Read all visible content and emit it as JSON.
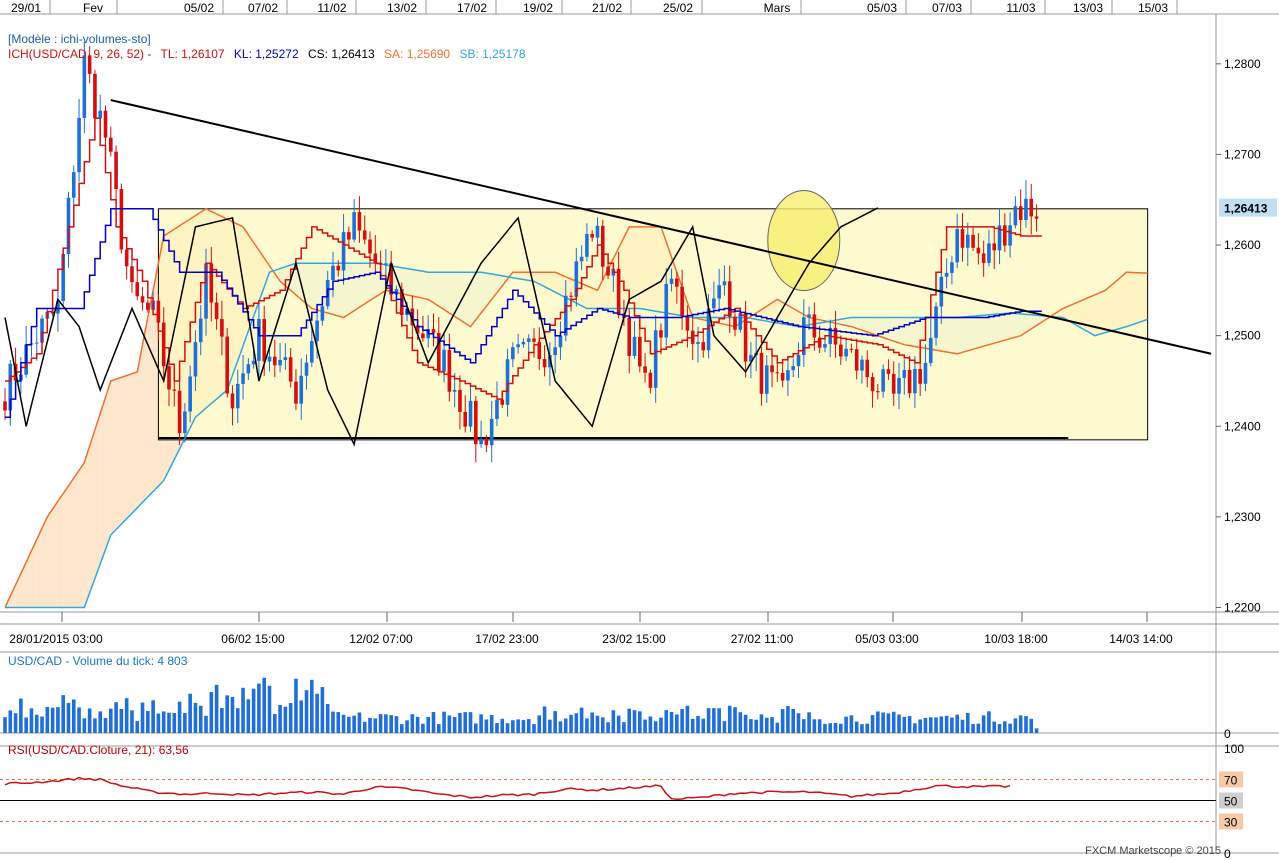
{
  "title": "",
  "top_date_labels": [
    "29/01",
    "Fev",
    "05/02",
    "07/02",
    "11/02",
    "13/02",
    "17/02",
    "19/02",
    "21/02",
    "25/02",
    "Mars",
    "05/03",
    "07/03",
    "11/03",
    "13/03",
    "15/03"
  ],
  "bottom_date_labels": [
    "28/01/2015 03:00",
    "06/02 15:00",
    "12/02 07:00",
    "17/02 23:00",
    "23/02 15:00",
    "27/02 11:00",
    "05/03 03:00",
    "10/03 18:00",
    "14/03 14:00"
  ],
  "legend": {
    "template": "[Modèle : ichi-volumes-sto]",
    "ichimoku": {
      "name": "ICH(USD/CAD, 9, 26, 52) -",
      "tl": "TL: 1,26107",
      "kl": "KL: 1,25272",
      "cs": "CS: 1,26413",
      "sa": "SA: 1,25690",
      "sb": "SB: 1,25178"
    },
    "volume": "USD/CAD - Volume du tick: 4 803",
    "rsi": "RSI(USD/CAD.Cloture, 21): 63,56"
  },
  "watermark": "FXCM Marketscope © 2015",
  "colors": {
    "up": "#1f6fd6",
    "down": "#d21010",
    "tenkan": "#d21010",
    "kijun": "#0000c8",
    "chikou": "#000000",
    "senkou_a": "#f07030",
    "senkou_b": "#30a8e0",
    "cloud_up": "#ddeef8",
    "cloud_down": "#fde6cc",
    "box": "#fdf8c0",
    "circle": "#f8ee6e",
    "price_badge": "#c0dff3"
  },
  "chart_data": [
    {
      "type": "candlestick",
      "name": "price",
      "ylim": [
        1.2195,
        1.2855
      ],
      "y_ticks": [
        "1,2200",
        "1,2300",
        "1,2400",
        "1,2500",
        "1,2600",
        "1,2700",
        "1,2800"
      ],
      "last_price_label": "1,26413",
      "bar_count": 196,
      "close_anchors": [
        [
          0,
          1.244
        ],
        [
          6,
          1.25
        ],
        [
          10,
          1.253
        ],
        [
          15,
          1.28
        ],
        [
          19,
          1.272
        ],
        [
          24,
          1.254
        ],
        [
          28,
          1.252
        ],
        [
          33,
          1.24
        ],
        [
          38,
          1.256
        ],
        [
          43,
          1.243
        ],
        [
          48,
          1.25
        ],
        [
          55,
          1.244
        ],
        [
          61,
          1.256
        ],
        [
          66,
          1.262
        ],
        [
          73,
          1.255
        ],
        [
          78,
          1.251
        ],
        [
          83,
          1.247
        ],
        [
          90,
          1.238
        ],
        [
          96,
          1.247
        ],
        [
          103,
          1.249
        ],
        [
          111,
          1.262
        ],
        [
          116,
          1.254
        ],
        [
          121,
          1.244
        ],
        [
          126,
          1.256
        ],
        [
          131,
          1.249
        ],
        [
          136,
          1.256
        ],
        [
          141,
          1.247
        ],
        [
          147,
          1.243
        ],
        [
          151,
          1.251
        ],
        [
          159,
          1.248
        ],
        [
          168,
          1.243
        ],
        [
          174,
          1.247
        ],
        [
          180,
          1.262
        ],
        [
          185,
          1.258
        ],
        [
          191,
          1.2641
        ]
      ],
      "overlays": {
        "tenkan_anchors": [
          [
            0,
            1.245
          ],
          [
            6,
            1.248
          ],
          [
            12,
            1.262
          ],
          [
            17,
            1.274
          ],
          [
            21,
            1.262
          ],
          [
            26,
            1.256
          ],
          [
            32,
            1.245
          ],
          [
            38,
            1.258
          ],
          [
            45,
            1.253
          ],
          [
            52,
            1.255
          ],
          [
            58,
            1.262
          ],
          [
            64,
            1.26
          ],
          [
            70,
            1.258
          ],
          [
            78,
            1.247
          ],
          [
            86,
            1.245
          ],
          [
            93,
            1.243
          ],
          [
            100,
            1.249
          ],
          [
            107,
            1.254
          ],
          [
            112,
            1.26
          ],
          [
            117,
            1.255
          ],
          [
            122,
            1.248
          ],
          [
            130,
            1.25
          ],
          [
            138,
            1.253
          ],
          [
            146,
            1.247
          ],
          [
            155,
            1.25
          ],
          [
            165,
            1.249
          ],
          [
            172,
            1.247
          ],
          [
            178,
            1.262
          ],
          [
            186,
            1.262
          ],
          [
            192,
            1.261
          ]
        ],
        "kijun_anchors": [
          [
            0,
            1.241
          ],
          [
            6,
            1.253
          ],
          [
            14,
            1.253
          ],
          [
            20,
            1.264
          ],
          [
            27,
            1.264
          ],
          [
            33,
            1.257
          ],
          [
            40,
            1.257
          ],
          [
            48,
            1.25
          ],
          [
            55,
            1.25
          ],
          [
            62,
            1.256
          ],
          [
            70,
            1.257
          ],
          [
            78,
            1.251
          ],
          [
            88,
            1.247
          ],
          [
            96,
            1.255
          ],
          [
            104,
            1.25
          ],
          [
            112,
            1.253
          ],
          [
            118,
            1.252
          ],
          [
            127,
            1.252
          ],
          [
            136,
            1.253
          ],
          [
            150,
            1.251
          ],
          [
            164,
            1.25
          ],
          [
            174,
            1.252
          ],
          [
            185,
            1.252
          ],
          [
            192,
            1.2527
          ]
        ],
        "chikou_anchors": [
          [
            0,
            1.252
          ],
          [
            4,
            1.24
          ],
          [
            10,
            1.254
          ],
          [
            14,
            1.251
          ],
          [
            18,
            1.244
          ],
          [
            24,
            1.253
          ],
          [
            30,
            1.245
          ],
          [
            36,
            1.262
          ],
          [
            43,
            1.263
          ],
          [
            48,
            1.245
          ],
          [
            55,
            1.258
          ],
          [
            61,
            1.244
          ],
          [
            66,
            1.238
          ],
          [
            73,
            1.258
          ],
          [
            80,
            1.247
          ],
          [
            90,
            1.258
          ],
          [
            97,
            1.263
          ],
          [
            104,
            1.245
          ],
          [
            111,
            1.24
          ],
          [
            118,
            1.254
          ],
          [
            124,
            1.256
          ],
          [
            130,
            1.262
          ],
          [
            134,
            1.25
          ],
          [
            140,
            1.246
          ],
          [
            147,
            1.253
          ],
          [
            152,
            1.258
          ],
          [
            158,
            1.262
          ],
          [
            165,
            1.2641
          ]
        ],
        "senkou_a_anchors": [
          [
            0,
            1.22
          ],
          [
            8,
            1.23
          ],
          [
            15,
            1.236
          ],
          [
            20,
            1.245
          ],
          [
            25,
            1.246
          ],
          [
            30,
            1.261
          ],
          [
            38,
            1.264
          ],
          [
            45,
            1.262
          ],
          [
            52,
            1.256
          ],
          [
            58,
            1.253
          ],
          [
            64,
            1.252
          ],
          [
            72,
            1.255
          ],
          [
            80,
            1.254
          ],
          [
            88,
            1.251
          ],
          [
            96,
            1.257
          ],
          [
            104,
            1.257
          ],
          [
            112,
            1.255
          ],
          [
            118,
            1.262
          ],
          [
            124,
            1.262
          ],
          [
            130,
            1.252
          ],
          [
            138,
            1.251
          ],
          [
            146,
            1.254
          ],
          [
            152,
            1.252
          ],
          [
            160,
            1.251
          ],
          [
            170,
            1.249
          ],
          [
            180,
            1.248
          ],
          [
            192,
            1.25
          ],
          [
            200,
            1.253
          ],
          [
            208,
            1.255
          ],
          [
            212,
            1.257
          ],
          [
            216,
            1.2569
          ]
        ],
        "senkou_b_anchors": [
          [
            0,
            1.22
          ],
          [
            15,
            1.22
          ],
          [
            20,
            1.228
          ],
          [
            25,
            1.231
          ],
          [
            30,
            1.234
          ],
          [
            36,
            1.241
          ],
          [
            42,
            1.244
          ],
          [
            50,
            1.257
          ],
          [
            55,
            1.258
          ],
          [
            62,
            1.258
          ],
          [
            70,
            1.258
          ],
          [
            80,
            1.257
          ],
          [
            90,
            1.257
          ],
          [
            100,
            1.256
          ],
          [
            110,
            1.253
          ],
          [
            120,
            1.253
          ],
          [
            130,
            1.252
          ],
          [
            140,
            1.252
          ],
          [
            150,
            1.251
          ],
          [
            160,
            1.252
          ],
          [
            170,
            1.252
          ],
          [
            180,
            1.252
          ],
          [
            190,
            1.2525
          ],
          [
            200,
            1.252
          ],
          [
            206,
            1.25
          ],
          [
            212,
            1.251
          ],
          [
            216,
            1.2518
          ]
        ],
        "trend_line": [
          [
            1.276,
            20
          ],
          [
            1.248,
            228
          ]
        ],
        "range_box": {
          "top": 1.264,
          "bottom": 1.2385,
          "from_bar": 29,
          "to_bar": 216
        },
        "support_line": 1.2387,
        "highlight_circle": {
          "bar": 151,
          "price": 1.2605
        }
      }
    },
    {
      "type": "bar",
      "name": "tick-volume",
      "ylabel": "",
      "ylim": [
        0,
        4803
      ],
      "y_ticks": [
        "0"
      ],
      "last_value": 4803
    },
    {
      "type": "line",
      "name": "rsi",
      "ylim": [
        0,
        100
      ],
      "y_ticks": [
        "100",
        "70",
        "50",
        "30",
        "0"
      ],
      "last_value": 63.56,
      "anchors": [
        [
          0,
          66
        ],
        [
          5,
          67
        ],
        [
          10,
          69
        ],
        [
          14,
          71
        ],
        [
          18,
          70
        ],
        [
          22,
          64
        ],
        [
          28,
          58
        ],
        [
          34,
          56
        ],
        [
          40,
          57
        ],
        [
          46,
          55
        ],
        [
          52,
          57
        ],
        [
          58,
          58
        ],
        [
          64,
          56
        ],
        [
          70,
          63
        ],
        [
          76,
          61
        ],
        [
          82,
          56
        ],
        [
          88,
          53
        ],
        [
          94,
          55
        ],
        [
          100,
          56
        ],
        [
          106,
          61
        ],
        [
          112,
          60
        ],
        [
          118,
          62
        ],
        [
          124,
          64
        ],
        [
          126,
          51
        ],
        [
          132,
          53
        ],
        [
          138,
          57
        ],
        [
          146,
          58
        ],
        [
          152,
          58
        ],
        [
          160,
          54
        ],
        [
          168,
          57
        ],
        [
          176,
          64
        ],
        [
          184,
          63
        ],
        [
          190,
          63.56
        ]
      ]
    }
  ]
}
